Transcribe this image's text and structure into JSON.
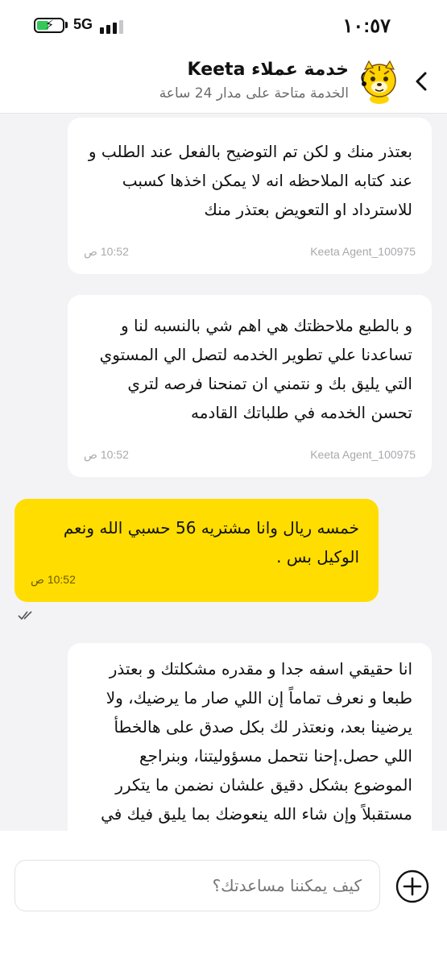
{
  "status_bar": {
    "time": "١٠:٥٧",
    "network": "5G",
    "battery_level_percent": 40
  },
  "header": {
    "title": "خدمة عملاء Keeta",
    "subtitle": "الخدمة متاحة على مدار 24 ساعة",
    "back_icon": "chevron-right-icon",
    "avatar_icon": "tiger-mascot-icon"
  },
  "messages": [
    {
      "from": "agent",
      "text": "بعتذر منك و لكن تم التوضيح بالفعل عند الطلب و عند كتابه الملاحظه انه لا يمكن اخذها كسبب للاسترداد او التعويض بعتذر منك",
      "time": "10:52 ص",
      "sender": "Keeta Agent_100975"
    },
    {
      "from": "agent",
      "text": "و بالطبع ملاحظتك هي اهم شي بالنسبه لنا و تساعدنا علي تطوير الخدمه لتصل الي المستوي التي يليق بك و نتمني ان تمنحنا فرصه لتري تحسن الخدمه في طلباتك القادمه",
      "time": "10:52 ص",
      "sender": "Keeta Agent_100975"
    },
    {
      "from": "user",
      "text": "خمسه ريال وانا مشتريه 56 حسبي الله ونعم الوكيل بس .",
      "time": "10:52 ص"
    },
    {
      "from": "agent",
      "text": "انا حقيقي اسفه جدا و مقدره مشكلتك و بعتذر طبعا و نعرف تماماً إن اللي صار ما يرضيك، ولا يرضينا بعد، ونعتذر لك بكل صدق على هالخطأ اللي حصل.إحنا نتحمل مسؤوليتنا، وبنراجع الموضوع بشكل دقيق علشان نضمن ما يتكرر مستقبلاً وإن شاء الله ينعوضك بما يليق فيك في طلباتك القادمه"
    }
  ],
  "composer": {
    "placeholder": "كيف يمكننا مساعدتك؟",
    "add_icon": "plus-circle-icon"
  },
  "colors": {
    "accent_yellow": "#FFDD00",
    "background": "#F3F3F5"
  }
}
